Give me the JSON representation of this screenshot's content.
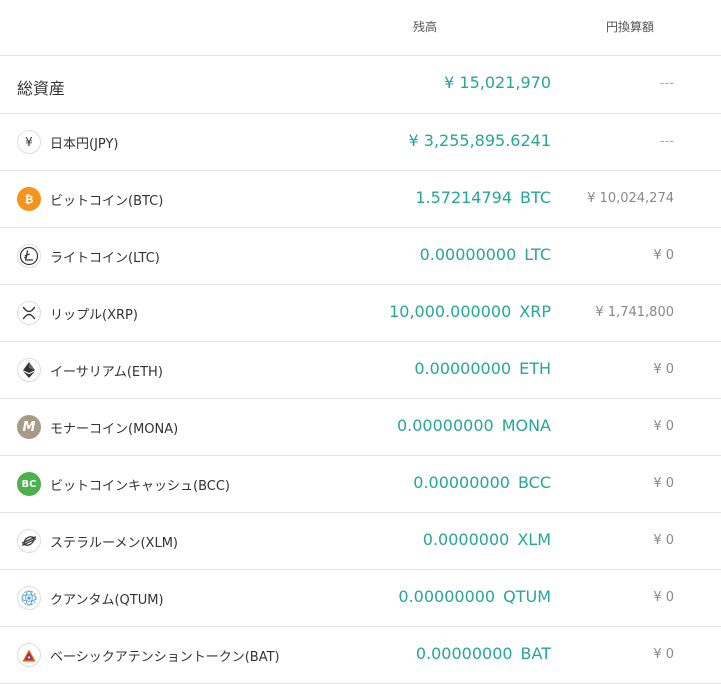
{
  "header": {
    "balance_label": "残高",
    "jpy_value_label": "円換算額"
  },
  "total": {
    "label": "総資産",
    "balance": "¥ 15,021,970",
    "jpy_value": "---"
  },
  "assets": [
    {
      "icon": "yen-icon",
      "name": "日本円(JPY)",
      "balance": "¥ 3,255,895.6241",
      "unit": "",
      "jpy_value": "---",
      "icon_color": "#ffffff"
    },
    {
      "icon": "bitcoin-icon",
      "name": "ビットコイン(BTC)",
      "balance": "1.57214794",
      "unit": "BTC",
      "jpy_value": "¥ 10,024,274",
      "icon_color": "#f7931a"
    },
    {
      "icon": "litecoin-icon",
      "name": "ライトコイン(LTC)",
      "balance": "0.00000000",
      "unit": "LTC",
      "jpy_value": "¥ 0",
      "icon_color": "#ffffff"
    },
    {
      "icon": "ripple-icon",
      "name": "リップル(XRP)",
      "balance": "10,000.000000",
      "unit": "XRP",
      "jpy_value": "¥ 1,741,800",
      "icon_color": "#ffffff"
    },
    {
      "icon": "ethereum-icon",
      "name": "イーサリアム(ETH)",
      "balance": "0.00000000",
      "unit": "ETH",
      "jpy_value": "¥ 0",
      "icon_color": "#ffffff"
    },
    {
      "icon": "monacoin-icon",
      "name": "モナーコイン(MONA)",
      "balance": "0.00000000",
      "unit": "MONA",
      "jpy_value": "¥ 0",
      "icon_color": "#a99a85"
    },
    {
      "icon": "bitcoin-cash-icon",
      "name": "ビットコインキャッシュ(BCC)",
      "balance": "0.00000000",
      "unit": "BCC",
      "jpy_value": "¥ 0",
      "icon_color": "#4cb04c"
    },
    {
      "icon": "stellar-icon",
      "name": "ステラルーメン(XLM)",
      "balance": "0.0000000",
      "unit": "XLM",
      "jpy_value": "¥ 0",
      "icon_color": "#ffffff"
    },
    {
      "icon": "qtum-icon",
      "name": "クアンタム(QTUM)",
      "balance": "0.00000000",
      "unit": "QTUM",
      "jpy_value": "¥ 0",
      "icon_color": "#ffffff"
    },
    {
      "icon": "bat-icon",
      "name": "ベーシックアテンショントークン(BAT)",
      "balance": "0.00000000",
      "unit": "BAT",
      "jpy_value": "¥ 0",
      "icon_color": "#ffffff"
    }
  ]
}
